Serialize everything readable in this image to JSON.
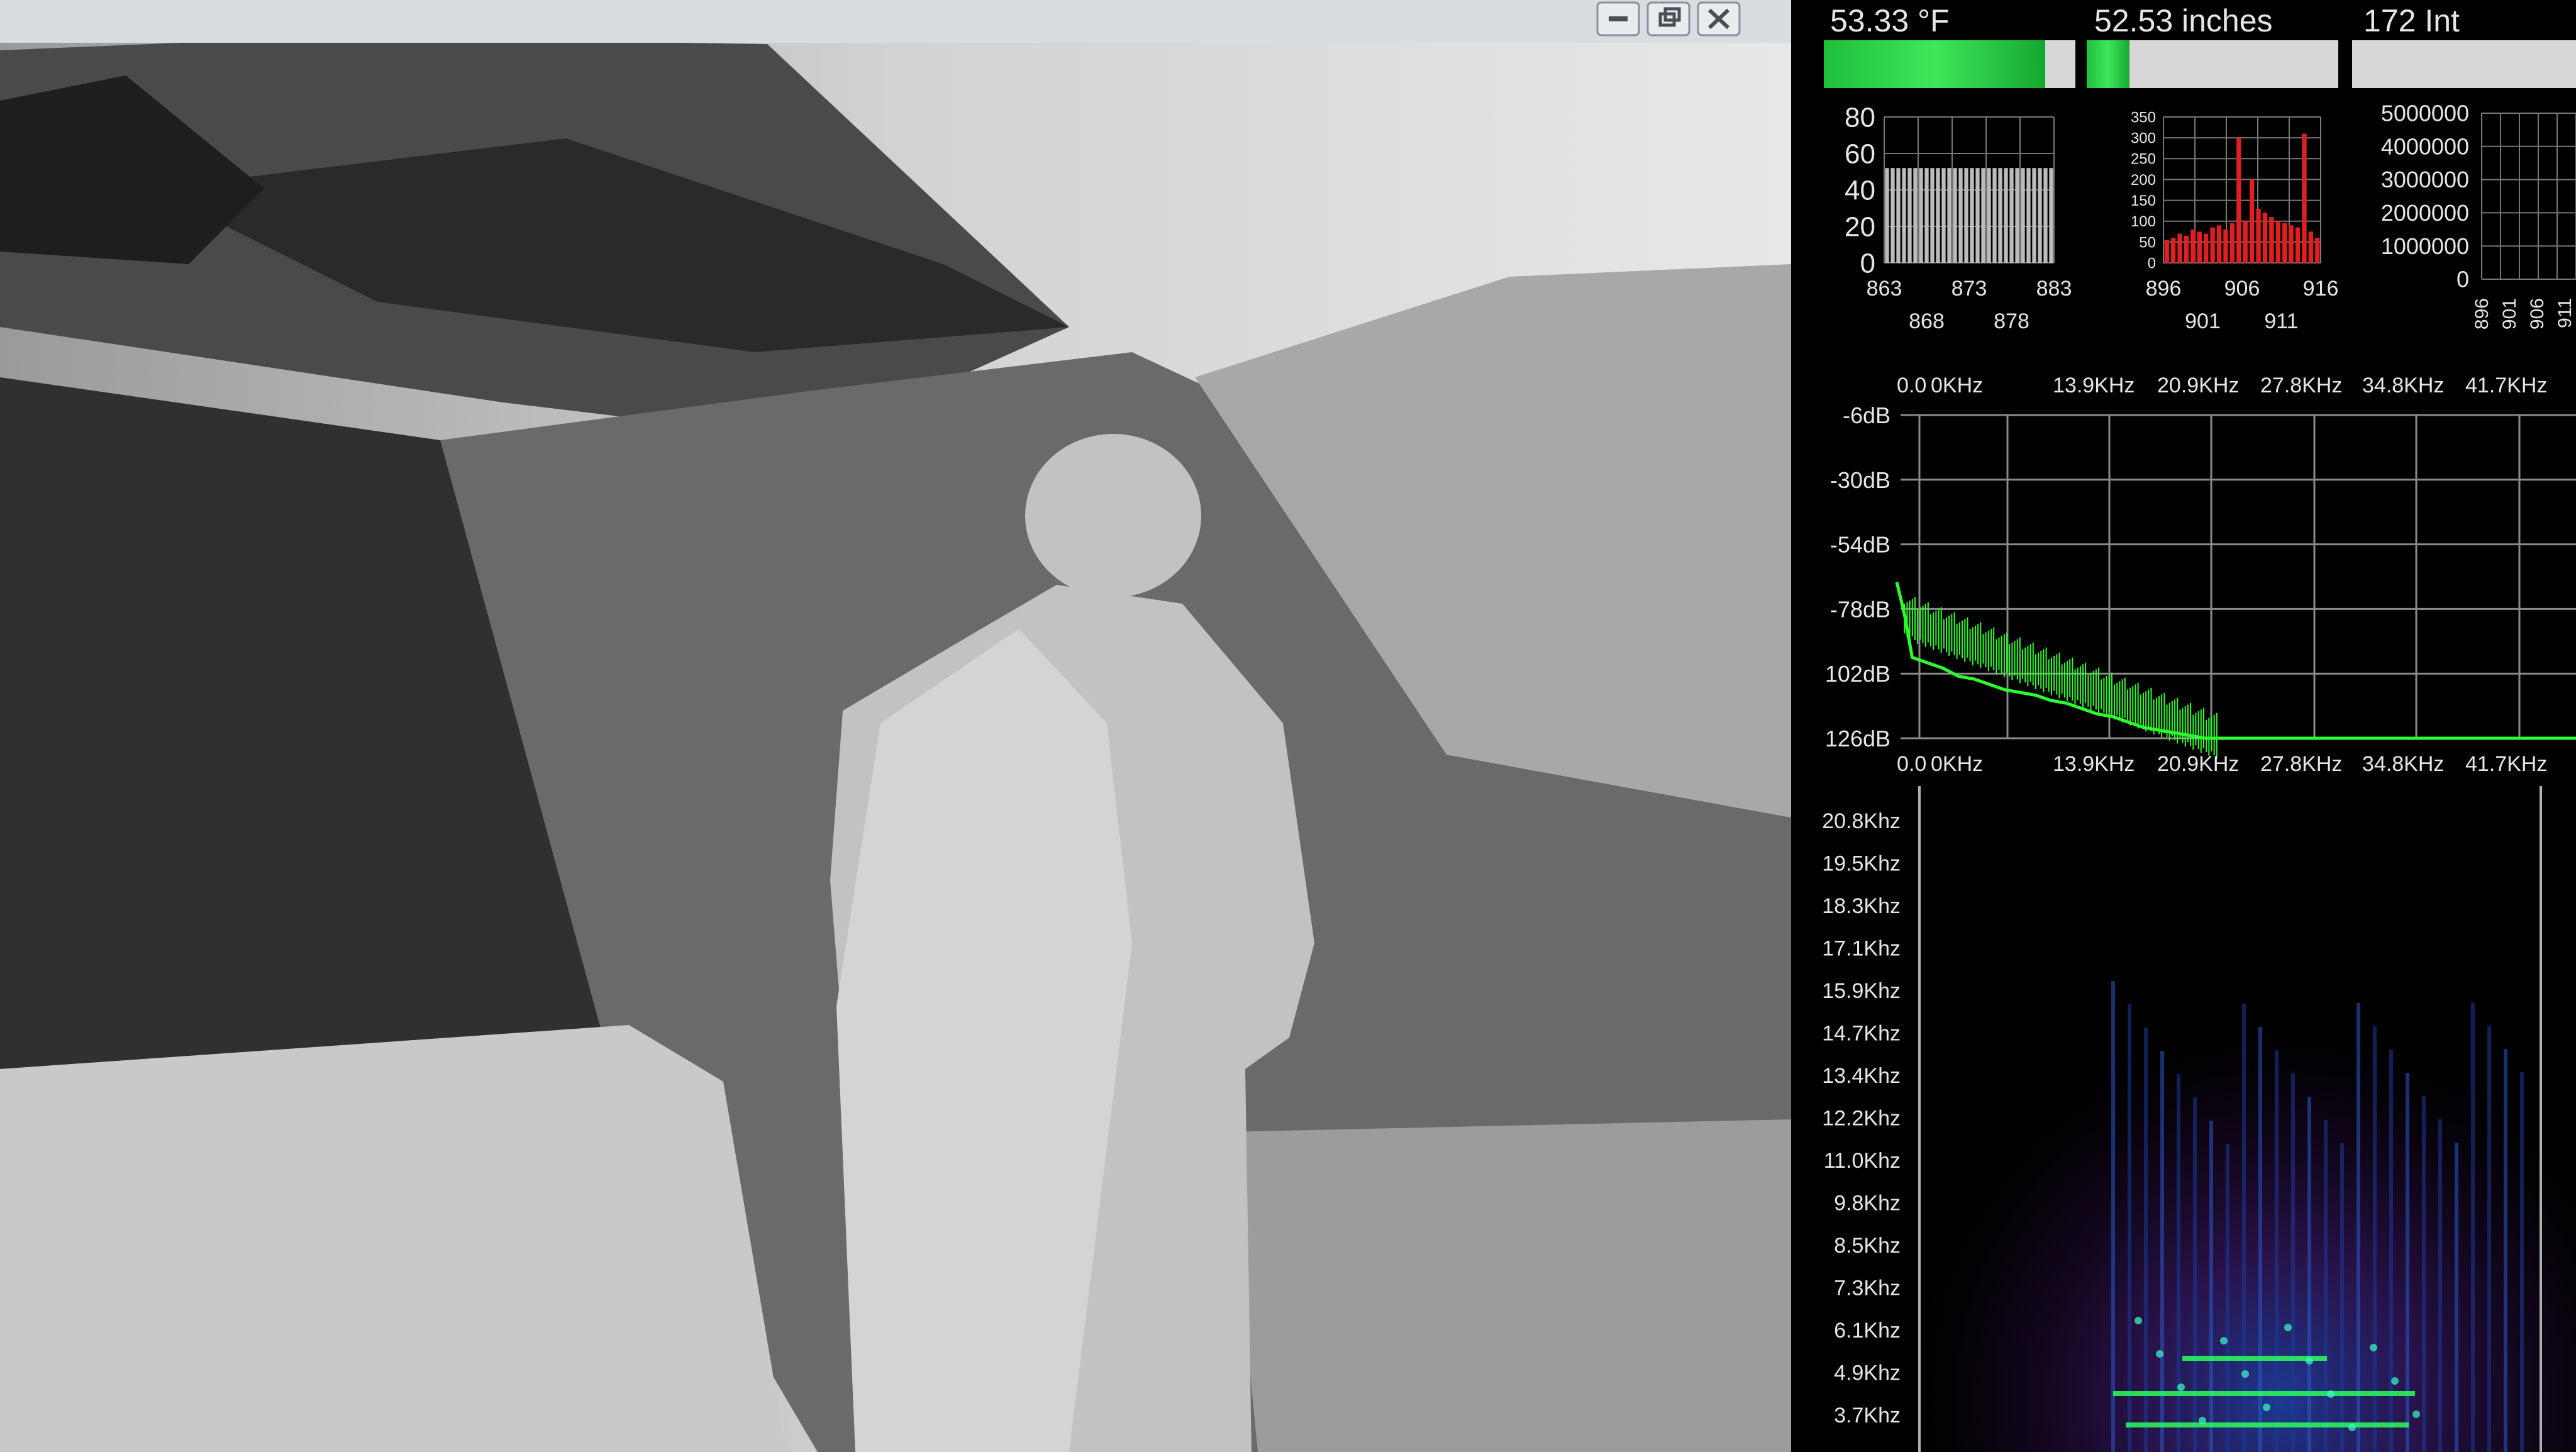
{
  "window_controls": {
    "minimize": "minimize-icon",
    "restore": "restore-icon",
    "close": "close-icon"
  },
  "readouts": [
    {
      "label": "53.33 °F",
      "fill": 0.88
    },
    {
      "label": "52.53 inches",
      "fill": 0.17
    },
    {
      "label": "172 Int",
      "fill": 0.0
    }
  ],
  "colors": {
    "bar_green": "#1fd641",
    "spectrum_line": "#2cff2c",
    "hist_red": "#e02020",
    "grid": "#8a8a8a",
    "label": "#e6e6e6"
  },
  "chart_data": [
    {
      "type": "bar",
      "ylim": [
        0,
        80
      ],
      "yticks": [
        "80",
        "60",
        "40",
        "20",
        "0"
      ],
      "xticks_row1": [
        "863",
        "873",
        "883"
      ],
      "xticks_row2": [
        "868",
        "878"
      ],
      "values": [
        52,
        52,
        52,
        52,
        52,
        52,
        52,
        52,
        52,
        52,
        52,
        52,
        52,
        52,
        52,
        52,
        52,
        52,
        52,
        52,
        52,
        52,
        52,
        52,
        52,
        52,
        52,
        52,
        52,
        52
      ]
    },
    {
      "type": "bar",
      "ylim": [
        0,
        350
      ],
      "yticks": [
        "350",
        "300",
        "250",
        "200",
        "150",
        "100",
        "50",
        "0"
      ],
      "xticks_row1": [
        "896",
        "906",
        "916"
      ],
      "xticks_row2": [
        "901",
        "911"
      ],
      "values": [
        55,
        60,
        70,
        65,
        80,
        75,
        70,
        85,
        90,
        80,
        95,
        300,
        100,
        200,
        130,
        120,
        110,
        100,
        95,
        90,
        85,
        310,
        75,
        60
      ]
    },
    {
      "type": "bar",
      "ylim": [
        0,
        5000000
      ],
      "yticks": [
        "5000000",
        "4000000",
        "3000000",
        "2000000",
        "1000000",
        "0"
      ],
      "xticks_rotated": [
        "896",
        "901",
        "906",
        "911"
      ],
      "values": []
    },
    {
      "type": "line",
      "xticks": [
        "0.0",
        "0KHz",
        "13.9KHz",
        "20.9KHz",
        "27.8KHz",
        "34.8KHz",
        "41.7KHz"
      ],
      "yticks": [
        "-6dB",
        "-30dB",
        "-54dB",
        "-78dB",
        "102dB",
        "126dB"
      ],
      "ylim": [
        -126,
        -6
      ],
      "x": [
        0.0,
        0.5,
        1.0,
        2.0,
        3.0,
        4.0,
        5.0,
        6.0,
        7.0,
        8.0,
        9.0,
        10.0,
        11.0,
        12.0,
        13.0,
        14.0,
        15.0,
        16.0,
        17.0,
        18.0,
        19.0,
        20.0,
        21.0,
        25.0,
        30.0,
        35.0,
        40.0,
        44.0
      ],
      "y": [
        -68,
        -80,
        -96,
        -98,
        -100,
        -103,
        -104,
        -106,
        -108,
        -109,
        -110,
        -112,
        -113,
        -115,
        -117,
        -118,
        -120,
        -122,
        -123,
        -124,
        -125,
        -126,
        -126,
        -126,
        -126,
        -126,
        -126,
        -126
      ]
    },
    {
      "type": "heatmap",
      "yticks": [
        "20.8Khz",
        "19.5Khz",
        "18.3Khz",
        "17.1Khz",
        "15.9Khz",
        "14.7Khz",
        "13.4Khz",
        "12.2Khz",
        "11.0Khz",
        "9.8Khz",
        "8.5Khz",
        "7.3Khz",
        "6.1Khz",
        "4.9Khz",
        "3.7Khz"
      ]
    }
  ]
}
